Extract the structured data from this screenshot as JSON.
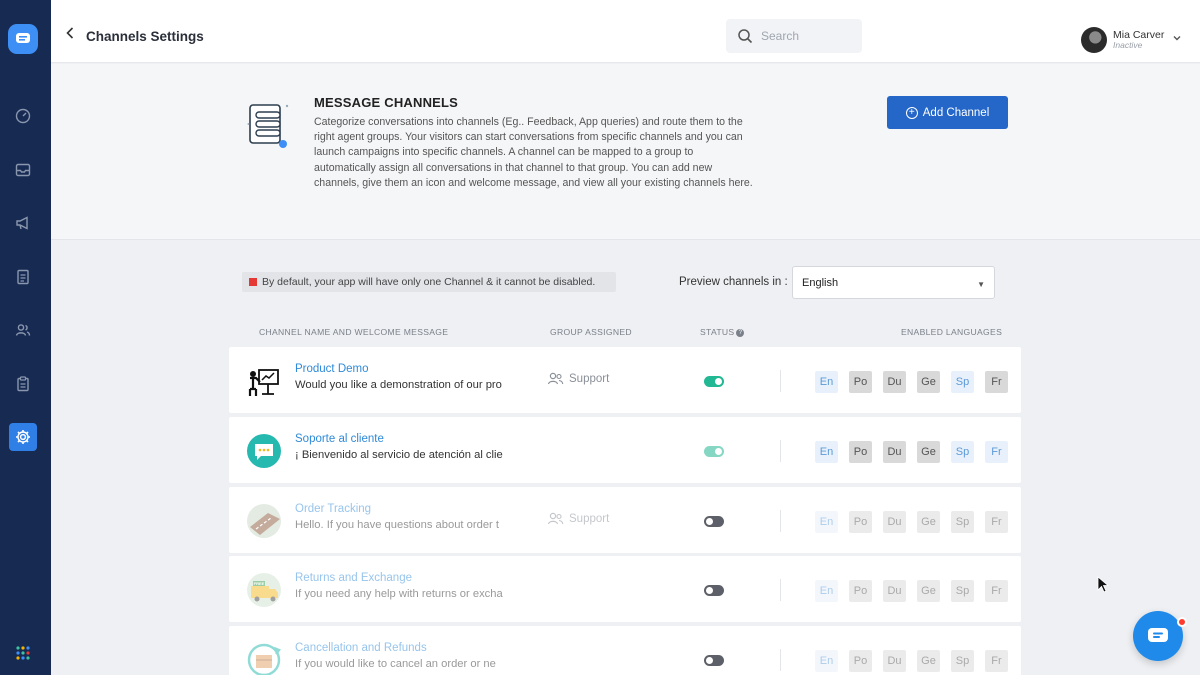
{
  "header": {
    "title": "Channels Settings",
    "search_placeholder": "Search",
    "user": {
      "name": "Mia Carver",
      "status": "Inactive"
    }
  },
  "sidebar": {
    "items": [
      {
        "icon": "dashboard-icon"
      },
      {
        "icon": "inbox-icon"
      },
      {
        "icon": "megaphone-icon"
      },
      {
        "icon": "document-icon"
      },
      {
        "icon": "users-icon"
      },
      {
        "icon": "clipboard-icon"
      },
      {
        "icon": "gear-icon",
        "active": true
      }
    ],
    "apps_icon": "grid-icon"
  },
  "intro": {
    "title": "MESSAGE CHANNELS",
    "description": "Categorize conversations into channels (Eg.. Feedback, App queries) and route them to the right agent groups. Your visitors can start conversations from specific channels and you can launch campaigns into specific channels. A channel can be mapped to a group to automatically assign all conversations in that channel to that group. You can add new channels, give them an icon and welcome message, and view all your existing channels here.",
    "add_button": "Add Channel"
  },
  "notice": "By default, your app will have only one Channel & it cannot be disabled.",
  "preview": {
    "label": "Preview channels in :",
    "selected": "English"
  },
  "table": {
    "headers": {
      "name": "CHANNEL NAME AND WELCOME MESSAGE",
      "group": "GROUP ASSIGNED",
      "status": "STATUS",
      "languages": "ENABLED LANGUAGES"
    },
    "rows": [
      {
        "name": "Product Demo",
        "message": "Would you like a demonstration of our pro",
        "group": "Support",
        "enabled": true,
        "faded": false,
        "languages": [
          {
            "code": "En",
            "on": true
          },
          {
            "code": "Po",
            "on": false
          },
          {
            "code": "Du",
            "on": false
          },
          {
            "code": "Ge",
            "on": false
          },
          {
            "code": "Sp",
            "on": true
          },
          {
            "code": "Fr",
            "on": false
          }
        ]
      },
      {
        "name": "Soporte al cliente",
        "message": "¡ Bienvenido al servicio de atención al clie",
        "group": "",
        "enabled": true,
        "faded": false,
        "languages": [
          {
            "code": "En",
            "on": true
          },
          {
            "code": "Po",
            "on": false
          },
          {
            "code": "Du",
            "on": false
          },
          {
            "code": "Ge",
            "on": false
          },
          {
            "code": "Sp",
            "on": true
          },
          {
            "code": "Fr",
            "on": true
          }
        ]
      },
      {
        "name": "Order Tracking",
        "message": "Hello. If you have questions about order t",
        "group": "Support",
        "enabled": false,
        "faded": true,
        "languages": [
          {
            "code": "En",
            "on": true
          },
          {
            "code": "Po",
            "on": false
          },
          {
            "code": "Du",
            "on": false
          },
          {
            "code": "Ge",
            "on": false
          },
          {
            "code": "Sp",
            "on": false
          },
          {
            "code": "Fr",
            "on": false
          }
        ]
      },
      {
        "name": "Returns and Exchange",
        "message": "If you need any help with returns or excha",
        "group": "",
        "enabled": false,
        "faded": true,
        "languages": [
          {
            "code": "En",
            "on": true
          },
          {
            "code": "Po",
            "on": false
          },
          {
            "code": "Du",
            "on": false
          },
          {
            "code": "Ge",
            "on": false
          },
          {
            "code": "Sp",
            "on": false
          },
          {
            "code": "Fr",
            "on": false
          }
        ]
      },
      {
        "name": "Cancellation and Refunds",
        "message": "If you would like to cancel an order or ne",
        "group": "",
        "enabled": false,
        "faded": true,
        "languages": [
          {
            "code": "En",
            "on": true
          },
          {
            "code": "Po",
            "on": false
          },
          {
            "code": "Du",
            "on": false
          },
          {
            "code": "Ge",
            "on": false
          },
          {
            "code": "Sp",
            "on": false
          },
          {
            "code": "Fr",
            "on": false
          }
        ]
      }
    ]
  },
  "colors": {
    "sidebar": "#162a52",
    "accent": "#2567c8",
    "link": "#2f8ad8",
    "toggle_on": "#22b893"
  }
}
